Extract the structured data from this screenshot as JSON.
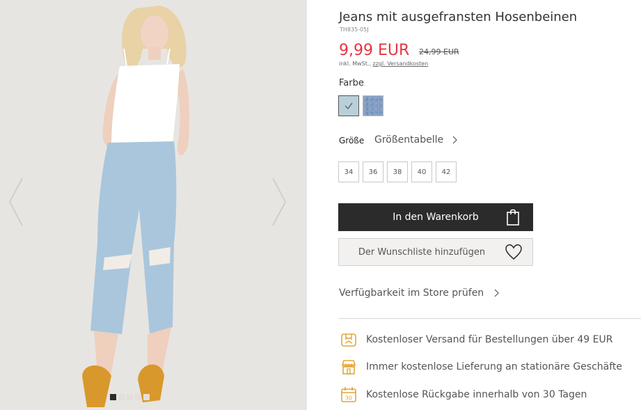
{
  "gallery": {
    "image_alt": "Model wearing light blue distressed jeans with frayed hems and a white camisole",
    "dots": [
      true,
      false,
      false,
      false,
      false
    ],
    "colors": {
      "bg": "#e7e5e2"
    }
  },
  "product": {
    "title": "Jeans mit ausgefransten Hosenbeinen",
    "sku": "TH835-05J",
    "price": "9,99 EUR",
    "old_price": "24,99 EUR",
    "tax_prefix": "inkl. MwSt.,",
    "shipping_link": "zzgl. Versandkosten",
    "price_color": "#e5363f"
  },
  "color": {
    "label": "Farbe",
    "swatches": [
      {
        "name": "light-blue",
        "selected": true
      },
      {
        "name": "denim-blue",
        "selected": false
      }
    ]
  },
  "size": {
    "label": "Größe",
    "chart_link": "Größentabelle",
    "options": [
      "34",
      "36",
      "38",
      "40",
      "42"
    ]
  },
  "actions": {
    "cart_label": "In den Warenkorb",
    "wishlist_label": "Der Wunschliste hinzufügen",
    "store_check_label": "Verfügbarkeit im Store prüfen"
  },
  "benefits": [
    {
      "icon": "shipping-box-icon",
      "text": "Kostenloser Versand für Bestellungen über 49 EUR"
    },
    {
      "icon": "store-icon",
      "text": "Immer kostenlose Lieferung an stationäre Geschäfte"
    },
    {
      "icon": "calendar-30-icon",
      "text": "Kostenlose Rückgabe innerhalb von 30 Tagen"
    }
  ],
  "accent_color": "#e0a63a"
}
